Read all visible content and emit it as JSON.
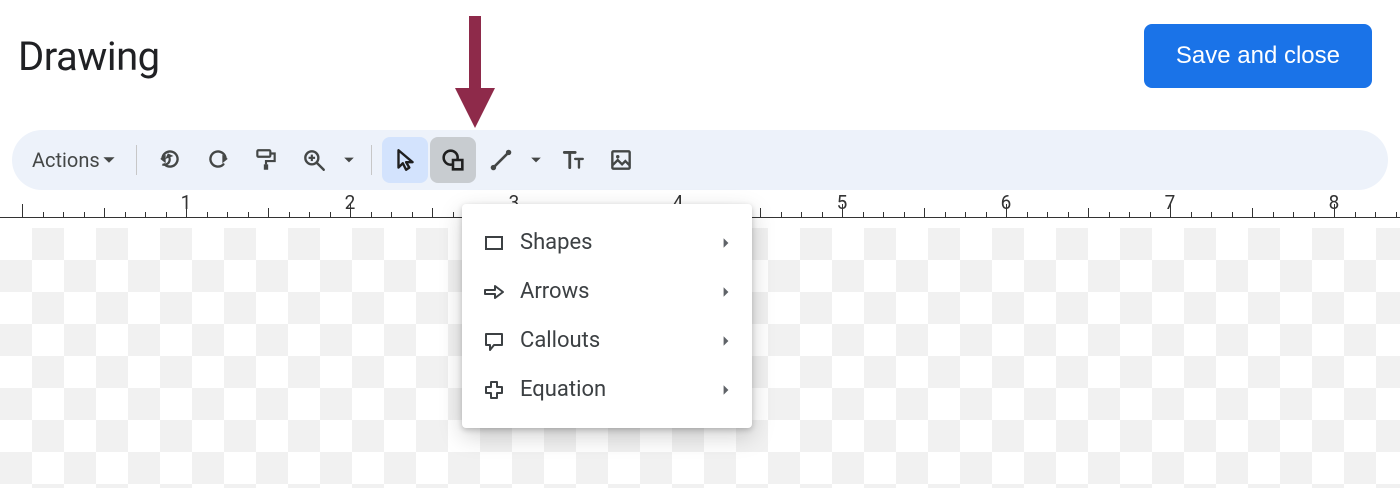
{
  "header": {
    "title": "Drawing",
    "save_label": "Save and close"
  },
  "toolbar": {
    "actions_label": "Actions",
    "tools": {
      "undo": "undo",
      "redo": "redo",
      "paint_format": "paint-format",
      "zoom": "zoom",
      "select": "select",
      "shape": "shape",
      "line": "line",
      "text": "text-box",
      "image": "image"
    }
  },
  "shape_menu": {
    "items": [
      {
        "icon": "rectangle",
        "label": "Shapes"
      },
      {
        "icon": "arrow-right",
        "label": "Arrows"
      },
      {
        "icon": "callout",
        "label": "Callouts"
      },
      {
        "icon": "plus",
        "label": "Equation"
      }
    ]
  },
  "ruler": {
    "marks": [
      "1",
      "2",
      "3",
      "4",
      "5",
      "6",
      "7",
      "8"
    ]
  },
  "annotation": {
    "arrow_color": "#8e2a4a"
  }
}
